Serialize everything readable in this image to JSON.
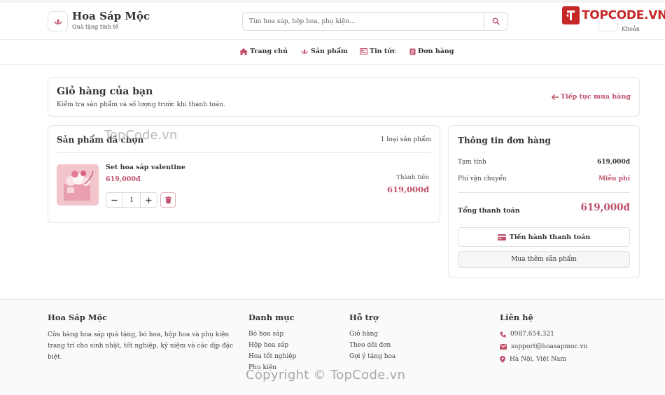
{
  "header": {
    "brand_name": "Hoa Sáp Mộc",
    "brand_tagline": "Quà tặng tinh tế",
    "search_placeholder": "Tìm hoa sáp, hộp hoa, phụ kiện...",
    "user_label": "Khoản",
    "watermark_logo": "TOPCODE.VN"
  },
  "nav": [
    {
      "label": "Trang chủ",
      "icon": "home-icon"
    },
    {
      "label": "Sản phẩm",
      "icon": "lotus-icon"
    },
    {
      "label": "Tin tức",
      "icon": "newspaper-icon"
    },
    {
      "label": "Đơn hàng",
      "icon": "receipt-icon"
    }
  ],
  "cart_header": {
    "title": "Giỏ hàng của bạn",
    "subtitle": "Kiểm tra sản phẩm và số lượng trước khi thanh toán.",
    "continue_label": "Tiếp tục mua hàng"
  },
  "product_list": {
    "title": "Sản phẩm đã chọn",
    "count_label": "1 loại sản phẩm",
    "items": [
      {
        "name": "Set hoa sáp valentine",
        "price": "619,000đ",
        "quantity": "1",
        "subtotal_label": "Thành tiền",
        "subtotal": "619,000đ"
      }
    ]
  },
  "summary": {
    "title": "Thông tin đơn hàng",
    "subtotal_label": "Tạm tính",
    "subtotal_value": "619,000đ",
    "shipping_label": "Phí vận chuyển",
    "shipping_value": "Miễn phí",
    "total_label": "Tổng thanh toán",
    "total_value": "619,000đ",
    "checkout_label": "Tiến hành thanh toán",
    "more_label": "Mua thêm sản phẩm"
  },
  "footer": {
    "about_title": "Hoa Sáp Mộc",
    "about_text": "Cửa hàng hoa sáp quà tặng, bó hoa, hộp hoa và phụ kiện trang trí cho sinh nhật, tốt nghiệp, kỷ niệm và các dịp đặc biệt.",
    "category_title": "Danh mục",
    "categories": [
      "Bó hoa sáp",
      "Hộp hoa sáp",
      "Hoa tốt nghiệp",
      "Phụ kiện"
    ],
    "support_title": "Hỗ trợ",
    "support_links": [
      "Giỏ hàng",
      "Theo dõi đơn",
      "Gợi ý tặng hoa"
    ],
    "contact_title": "Liên hệ",
    "phone": "0987.654.321",
    "email": "support@hoasapmoc.vn",
    "address": "Hà Nội, Việt Nam"
  },
  "watermarks": {
    "copyright": "Copyright © TopCode.vn",
    "topcode": "TopCode.vn"
  },
  "colors": {
    "accent": "#c0506a",
    "brand_red": "#c62828"
  }
}
